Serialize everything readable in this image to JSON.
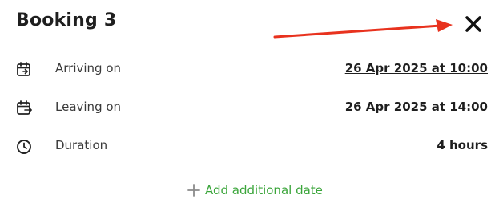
{
  "modal": {
    "title": "Booking 3"
  },
  "details": {
    "arriving": {
      "label": "Arriving on",
      "value": "26 Apr 2025 at 10:00",
      "icon": "calendar-arrive-icon"
    },
    "leaving": {
      "label": "Leaving on",
      "value": "26 Apr 2025 at 14:00",
      "icon": "calendar-leave-icon"
    },
    "duration": {
      "label": "Duration",
      "value": "4 hours",
      "icon": "clock-icon"
    }
  },
  "actions": {
    "add_date_label": "Add additional date",
    "close_icon": "close-icon"
  },
  "colors": {
    "accent_green": "#3aa53a",
    "annotation_red": "#e8321e",
    "text": "#1f1f1f"
  }
}
